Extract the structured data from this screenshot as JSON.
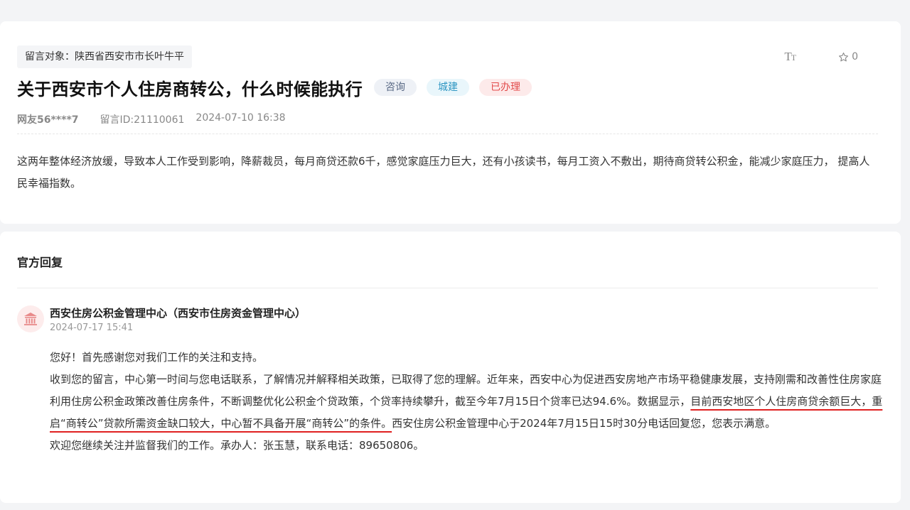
{
  "message": {
    "target": "留言对象：陕西省西安市市长叶牛平",
    "title": "关于西安市个人住房商转公，什么时候能执行",
    "tags": [
      "咨询",
      "城建",
      "已办理"
    ],
    "tools": {
      "font_label": "TT",
      "favorite_count": "0"
    },
    "author": "网友56****7",
    "message_id": "留言ID:21110061",
    "datetime": "2024-07-10 16:38",
    "content": "这两年整体经济放缓，导致本人工作受到影响，降薪裁员，每月商贷还款6千，感觉家庭压力巨大，还有小孩读书，每月工资入不敷出，期待商贷转公积金，能减少家庭压力， 提高人民幸福指数。"
  },
  "reply": {
    "heading": "官方回复",
    "org": "西安住房公积金管理中心（西安市住房资金管理中心）",
    "date": "2024-07-17 15:41",
    "greeting": "您好！首先感谢您对我们工作的关注和支持。",
    "body_before": "收到您的留言，中心第一时间与您电话联系，了解情况并解释相关政策，已取得了您的理解。近年来，西安中心为促进西安房地产市场平稳健康发展，支持刚需和改善性住房家庭利用住房公积金政策改善住房条件，不断调整优化公积金个贷政策，个贷率持续攀升，截至今年7月15日个贷率已达94.6%。数据显示，",
    "body_highlight": "目前西安地区个人住房商贷余额巨大，重启“商转公”贷款所需资金缺口较大，中心暂不具备开展“商转公”的条件。",
    "body_after": "西安住房公积金管理中心于2024年7月15日15时30分电话回复您，您表示满意。",
    "closing": "欢迎您继续关注并监督我们的工作。承办人：张玉慧，联系电话：89650806。"
  }
}
